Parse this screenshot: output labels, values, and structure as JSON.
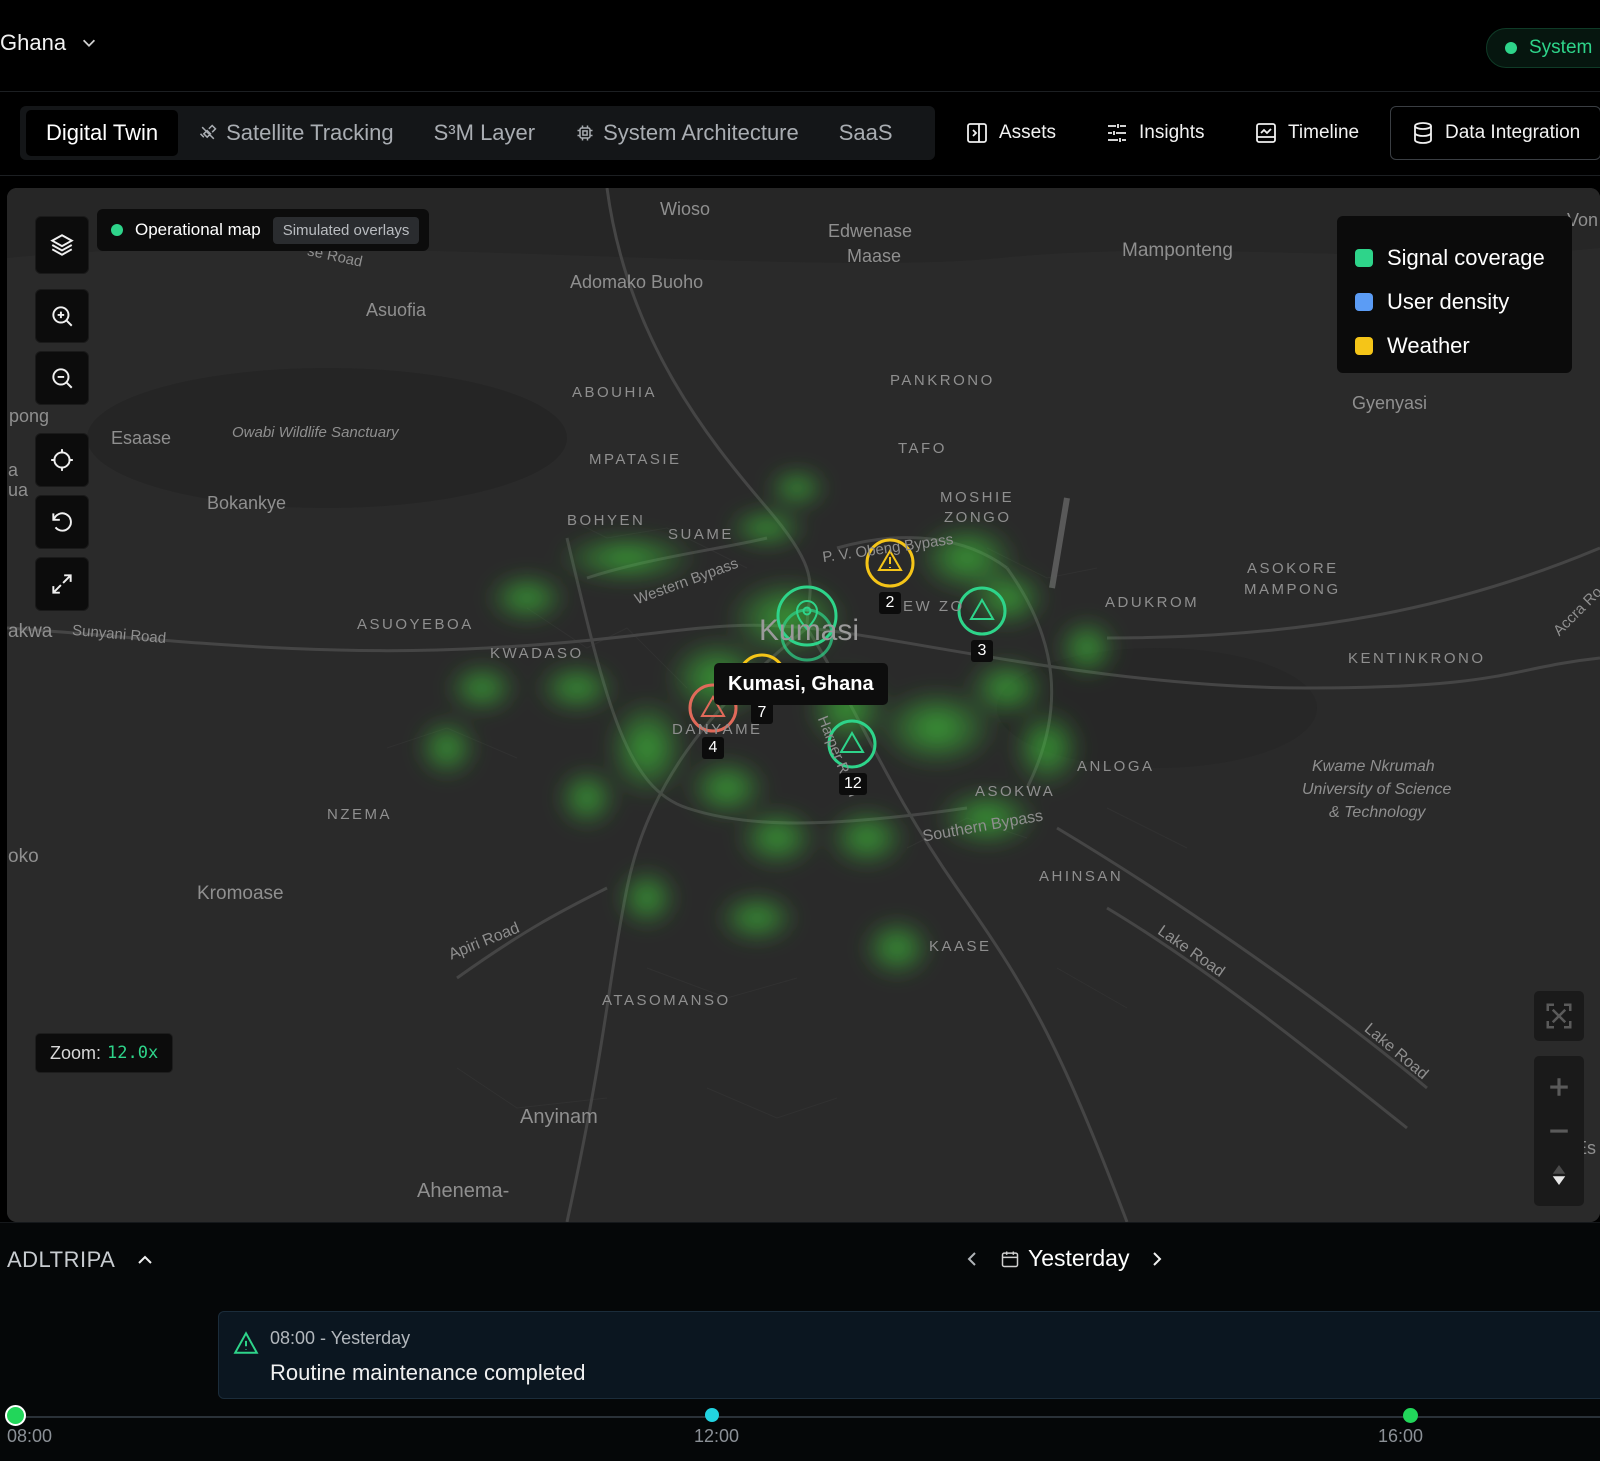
{
  "header": {
    "region": "Ghana",
    "system_status": "System"
  },
  "nav": {
    "tabs": [
      {
        "label": "Digital Twin",
        "icon": "none"
      },
      {
        "label": "Satellite Tracking",
        "icon": "satellite-icon"
      },
      {
        "label": "S³M Layer",
        "icon": "none"
      },
      {
        "label": "System Architecture",
        "icon": "chip-icon"
      },
      {
        "label": "SaaS",
        "icon": "none"
      }
    ],
    "links": [
      {
        "label": "Assets",
        "icon": "panel-icon"
      },
      {
        "label": "Insights",
        "icon": "sliders-icon"
      },
      {
        "label": "Timeline",
        "icon": "calendar-chart-icon"
      },
      {
        "label": "Data Integration",
        "icon": "database-icon"
      }
    ]
  },
  "map": {
    "mode_label": "Operational map",
    "overlay_tag": "Simulated overlays",
    "zoom_label": "Zoom:",
    "zoom_value": "12.0x",
    "tooltip": "Kumasi, Ghana",
    "city_label": "Kumasi",
    "legend": [
      {
        "label": "Signal coverage",
        "color": "#2ed48a"
      },
      {
        "label": "User density",
        "color": "#5b9cf5"
      },
      {
        "label": "Weather",
        "color": "#f5c518"
      }
    ],
    "markers": [
      {
        "count": "2",
        "kind": "weather"
      },
      {
        "count": "3",
        "kind": "signal"
      },
      {
        "count": "7",
        "kind": "weather"
      },
      {
        "count": "4",
        "kind": "alert"
      },
      {
        "count": "12",
        "kind": "signal"
      }
    ],
    "place_labels": {
      "wioso": "Wioso",
      "edwenase": "Edwenase",
      "maase": "Maase",
      "mamponteng": "Mamponteng",
      "adomako": "Adomako Buoho",
      "asuofia": "Asuofia",
      "road_top": "se Road",
      "abouhia": "ABOUHIA",
      "pankrono": "PANKRONO",
      "gyenyasi": "Gyenyasi",
      "pong": "pong",
      "esaase": "Esaase",
      "owabi": "Owabi Wildlife Sanctuary",
      "mpatasie": "MPATASIE",
      "tafo": "TAFO",
      "a": "a",
      "ua": "ua",
      "bokankye": "Bokankye",
      "moshie": "MOSHIE",
      "zongo": "ZONGO",
      "bohyen": "BOHYEN",
      "suame": "SUAME",
      "pv_bypass": "P. V. Obeng Bypass",
      "western_bypass": "Western Bypass",
      "asokore": "ASOKORE",
      "mampong": "MAMPONG",
      "new_zongo": "EW ZO",
      "adukrom": "ADUKROM",
      "akwa": "akwa",
      "sunyani": "Sunyani Road",
      "asuoyeboa": "ASUOYEBOA",
      "kwadaso": "KWADASO",
      "kentinkrono": "KENTINKRONO",
      "accra": "Accra Ro",
      "danyame": "DANYAME",
      "harper": "Harper Road",
      "anloga": "ANLOGA",
      "knust1": "Kwame Nkrumah",
      "knust2": "University of Science",
      "knust3": "& Technology",
      "asokwa": "ASOKWA",
      "nzema": "NZEMA",
      "southern": "Southern Bypass",
      "oko": "oko",
      "ahinsan": "AHINSAN",
      "kromoase": "Kromoase",
      "apiri": "Apiri Road",
      "kaase": "KAASE",
      "lake1": "Lake Road",
      "atasomanso": "ATASOMANSO",
      "lake2": "Lake Road",
      "anyinam": "Anyinam",
      "es": "Es",
      "ahenema": "Ahenema-",
      "von": "Von"
    }
  },
  "timeline": {
    "title": "ADLTRIPA",
    "date_label": "Yesterday",
    "event": {
      "time": "08:00 - Yesterday",
      "message": "Routine maintenance completed"
    },
    "ticks": [
      "08:00",
      "12:00",
      "16:00"
    ]
  }
}
